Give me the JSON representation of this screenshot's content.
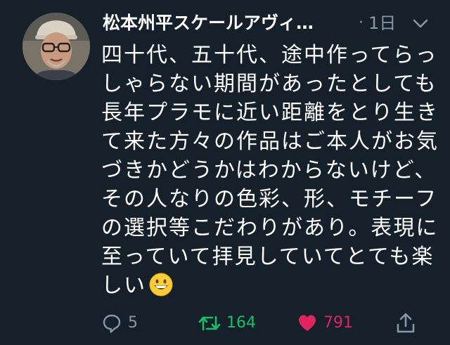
{
  "tweet": {
    "author": {
      "display_name": "松本州平スケールアヴィ…"
    },
    "separator": "·",
    "timestamp": "1日",
    "text_lines": [
      "四十代、五十代、途中作ってらっ",
      "しゃらない期間があったとしても",
      "長年プラモに近い距離をとり生き",
      "て来た方々の作品はご本人がお気",
      "づきかどうかはわからないけど、",
      "その人なりの色彩、形、モチーフ",
      "の選択等こだわりがあり。表現に",
      "至っていて拝見していてとても楽",
      "しい"
    ],
    "emoji": "grinning-face",
    "actions": {
      "reply_count": "5",
      "retweet_count": "164",
      "like_count": "791"
    }
  },
  "colors": {
    "background": "#15202b",
    "text": "#ffffff",
    "secondary": "#8899a6",
    "retweet_active": "#17bf63",
    "like_active": "#e0245e"
  },
  "icons": {
    "reply": "reply-icon",
    "retweet": "retweet-icon",
    "like": "heart-icon",
    "share": "share-icon",
    "more": "chevron-down-icon"
  }
}
